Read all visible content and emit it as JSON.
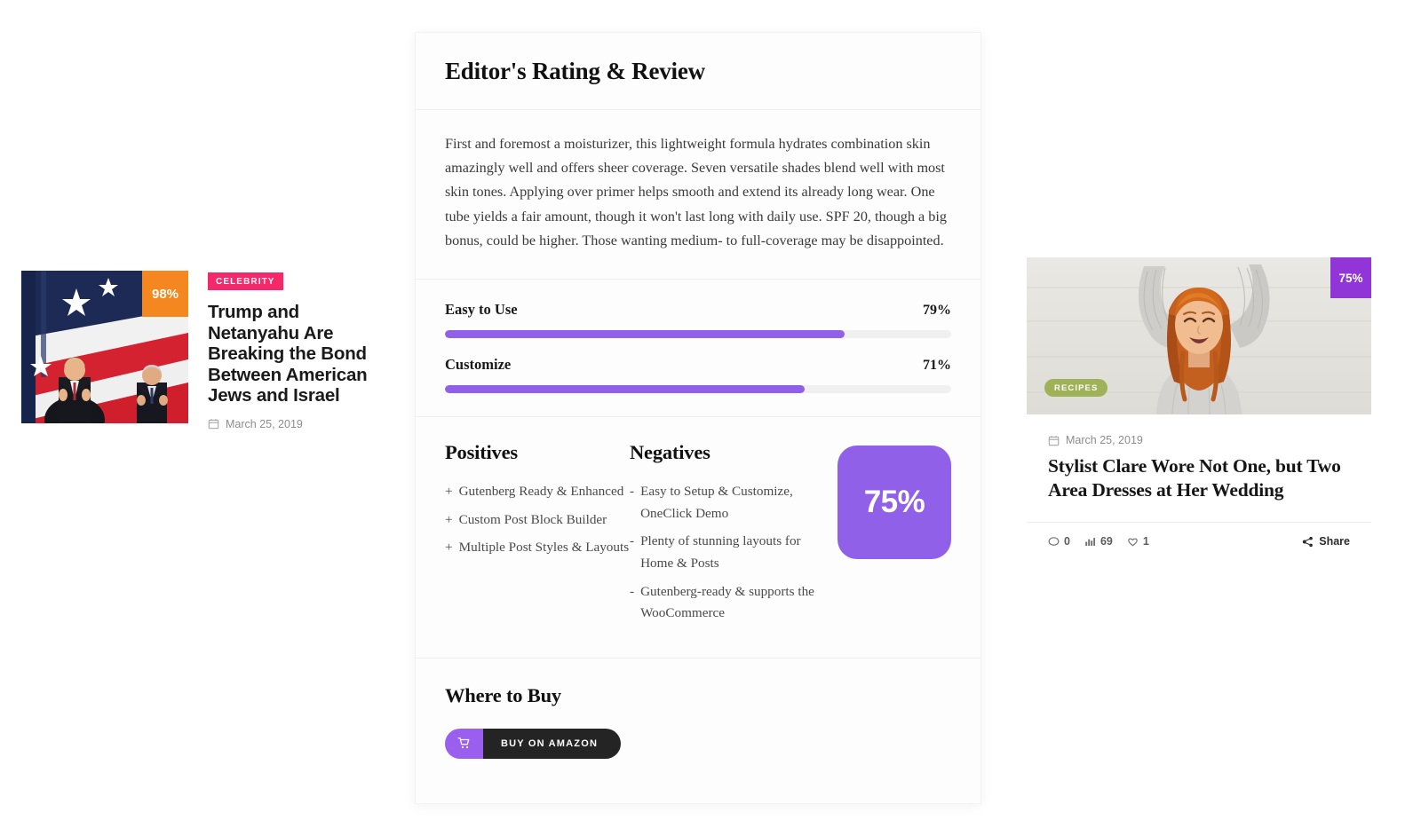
{
  "left_article": {
    "category_tag": "CELEBRITY",
    "score_badge": "98%",
    "title": "Trump and Netanyahu Are Breaking the Bond Between American Jews and Israel",
    "date": "March 25, 2019",
    "colors": {
      "tag": "#f5286b",
      "badge": "#f4871f"
    }
  },
  "review": {
    "title": "Editor's Rating & Review",
    "summary": "First and foremost a moisturizer, this lightweight formula hydrates combination skin amazingly well and offers sheer coverage. Seven versatile shades blend well with most skin tones. Applying over primer helps smooth and extend its already long wear. One tube yields a fair amount, though it won't last long with daily use. SPF 20, though a big bonus, could be higher. Those wanting medium- to full-coverage may be disappointed.",
    "criteria": [
      {
        "name": "Easy to Use",
        "percent_label": "79%",
        "percent": 79
      },
      {
        "name": "Customize",
        "percent_label": "71%",
        "percent": 71
      }
    ],
    "positives": {
      "heading": "Positives",
      "sign": "+",
      "items": [
        "Gutenberg Ready & Enhanced",
        "Custom Post Block Builder",
        "Multiple Post Styles & Layouts"
      ]
    },
    "negatives": {
      "heading": "Negatives",
      "sign": "-",
      "items": [
        "Easy to Setup & Customize, OneClick Demo",
        "Plenty of stunning layouts for Home & Posts",
        "Gutenberg-ready & supports the WooCommerce"
      ]
    },
    "overall_score": "75%",
    "where_to_buy": {
      "heading": "Where to Buy",
      "button_label": "BUY ON AMAZON",
      "button_icon": "shopping-cart-icon"
    },
    "accent_color": "#9061e8"
  },
  "right_article": {
    "score_badge": "75%",
    "category_tag": "RECIPES",
    "date": "March 25, 2019",
    "title": "Stylist Clare Wore Not One, but Two Area Dresses at Her Wedding",
    "stats": {
      "comments": "0",
      "views": "69",
      "likes": "1"
    },
    "share_label": "Share",
    "colors": {
      "tag": "#a0b258",
      "badge": "#9134d8"
    }
  }
}
